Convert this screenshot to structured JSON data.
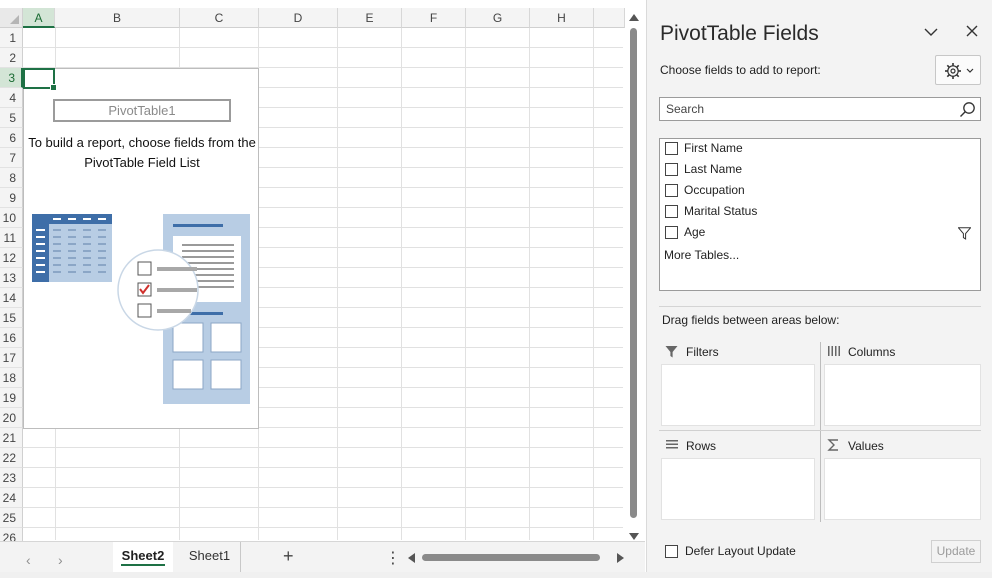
{
  "sheet": {
    "columns": [
      "A",
      "B",
      "C",
      "D",
      "E",
      "F",
      "G",
      "H"
    ],
    "rows": [
      "1",
      "2",
      "3",
      "4",
      "5",
      "6",
      "7",
      "8",
      "9",
      "10",
      "11",
      "12",
      "13",
      "14",
      "15",
      "16",
      "17",
      "18",
      "19",
      "20",
      "21",
      "22",
      "23",
      "24",
      "25",
      "26"
    ],
    "selected_column": "A",
    "selected_row": "3",
    "pivot_placeholder": {
      "name": "PivotTable1",
      "instructions": "To build a report, choose fields from the PivotTable Field List"
    },
    "tabs": [
      {
        "label": "Sheet2",
        "active": true
      },
      {
        "label": "Sheet1",
        "active": false
      }
    ],
    "add_sheet_label": "+",
    "tab_menu_label": "⋮",
    "nav_prev": "‹",
    "nav_next": "›"
  },
  "pane": {
    "title": "PivotTable Fields",
    "choose_label": "Choose fields to add to report:",
    "search_placeholder": "Search",
    "fields": [
      {
        "label": "First Name",
        "checked": false
      },
      {
        "label": "Last Name",
        "checked": false
      },
      {
        "label": "Occupation",
        "checked": false
      },
      {
        "label": "Marital Status",
        "checked": false
      },
      {
        "label": "Age",
        "checked": false
      }
    ],
    "more_tables": "More Tables...",
    "drag_label": "Drag fields between areas below:",
    "areas": {
      "filters": "Filters",
      "columns": "Columns",
      "rows": "Rows",
      "values": "Values"
    },
    "defer_label": "Defer Layout Update",
    "update_label": "Update"
  },
  "colors": {
    "excel_green": "#1e7145",
    "illustration_blue": "#3e6ea8",
    "illustration_light": "#b8cde4"
  },
  "icons": [
    "collapse-chevron-icon",
    "close-icon",
    "gear-icon",
    "search-icon",
    "filter-icon",
    "columns-icon",
    "rows-icon",
    "sigma-icon"
  ]
}
